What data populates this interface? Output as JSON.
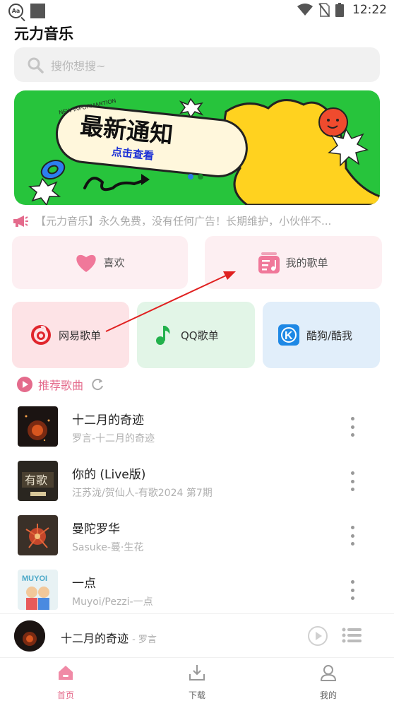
{
  "status_bar": {
    "time": "12:22"
  },
  "app": {
    "title": "元力音乐"
  },
  "search": {
    "placeholder": "搜你想搜~"
  },
  "banner": {
    "headline": "最新通知",
    "subline": "点击查看",
    "curved_text": "NEW INFORMARTION"
  },
  "notice": {
    "text": "【元力音乐】永久免费，没有任何广告！长期维护，小伙伴不..."
  },
  "quick_cards": {
    "like_label": "喜欢",
    "mylist_label": "我的歌单"
  },
  "platform_cards": [
    {
      "label": "网易歌单"
    },
    {
      "label": "QQ歌单"
    },
    {
      "label": "酷狗/酷我"
    }
  ],
  "recommend": {
    "label": "推荐歌曲"
  },
  "songs": [
    {
      "title": "十二月的奇迹",
      "subtitle": "罗言-十二月的奇迹"
    },
    {
      "title": "你的 (Live版)",
      "subtitle": "汪苏泷/贺仙人-有歌2024 第7期"
    },
    {
      "title": "曼陀罗华",
      "subtitle": "Sasuke-蔓·生花"
    },
    {
      "title": "一点",
      "subtitle": "Muyoi/Pezzi-一点"
    }
  ],
  "player": {
    "title": "十二月的奇迹",
    "artist": "- 罗言"
  },
  "tabs": [
    {
      "label": "首页"
    },
    {
      "label": "下载"
    },
    {
      "label": "我的"
    }
  ],
  "colors": {
    "accent": "#e46b8c",
    "banner_green": "#27c43c",
    "annotation_arrow": "#e02020"
  }
}
